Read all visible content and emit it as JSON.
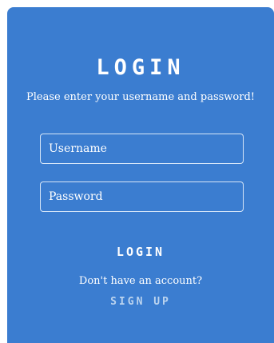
{
  "login_card": {
    "title": "LOGIN",
    "subtitle": "Please enter your username and password!",
    "username": {
      "placeholder": "Username",
      "value": ""
    },
    "password": {
      "placeholder": "Password",
      "value": ""
    },
    "login_button_label": "LOGIN",
    "signup_prompt": "Don't have an account?",
    "signup_link_label": "SIGN UP"
  },
  "colors": {
    "card_background": "#3b7dd0",
    "text": "#ffffff",
    "link": "#bcd4ef",
    "field_border": "#d6e6f8"
  }
}
